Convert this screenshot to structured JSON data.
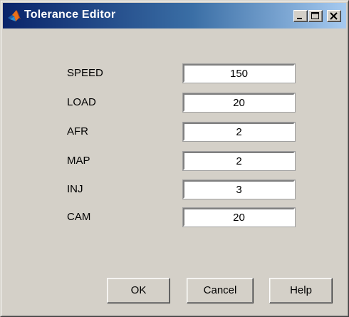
{
  "window": {
    "title": "Tolerance Editor",
    "controls": {
      "minimize": "minimize",
      "maximize": "maximize",
      "close": "close"
    }
  },
  "fields": [
    {
      "label": "SPEED",
      "value": "150"
    },
    {
      "label": "LOAD",
      "value": "20"
    },
    {
      "label": "AFR",
      "value": "2"
    },
    {
      "label": "MAP",
      "value": "2"
    },
    {
      "label": "INJ",
      "value": "3"
    },
    {
      "label": "CAM",
      "value": "20"
    }
  ],
  "buttons": {
    "ok": "OK",
    "cancel": "Cancel",
    "help": "Help"
  },
  "colors": {
    "titlebar_start": "#0a246a",
    "titlebar_end": "#a6caf0",
    "dialog_face": "#d4d0c8"
  },
  "icons": {
    "app": "matlab-logo-icon",
    "minimize": "minimize-icon",
    "maximize": "maximize-icon",
    "close": "close-icon"
  }
}
